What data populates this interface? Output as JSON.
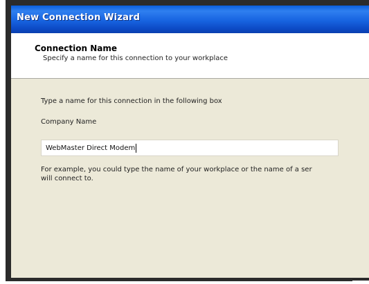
{
  "window": {
    "title": "New Connection Wizard"
  },
  "header": {
    "title": "Connection Name",
    "subtitle": "Specify a name for this connection to your workplace"
  },
  "body": {
    "instruction": "Type a name for this connection in the following box",
    "field_label": "Company Name",
    "field_value": "WebMaster Direct Modem",
    "example_line1": "For example, you could type the name of your workplace or the name of a ser",
    "example_line2": "will connect to."
  }
}
